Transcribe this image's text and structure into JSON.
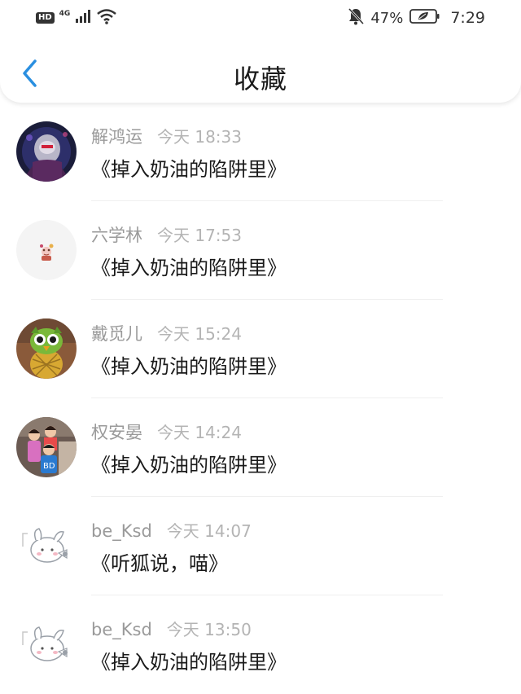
{
  "status_bar": {
    "hd": "HD",
    "network": "4G",
    "battery_percent": "47%",
    "time": "7:29"
  },
  "header": {
    "title": "收藏",
    "back_icon": "chevron-left-icon",
    "accent_color": "#2a8fe0"
  },
  "favorites": [
    {
      "user": "解鸿运",
      "time": "今天 18:33",
      "book": "《掉入奶油的陷阱里》",
      "avatar": "avatar-robot"
    },
    {
      "user": "六学林",
      "time": "今天 17:53",
      "book": "《掉入奶油的陷阱里》",
      "avatar": "avatar-sticker"
    },
    {
      "user": "戴觅儿",
      "time": "今天 15:24",
      "book": "《掉入奶油的陷阱里》",
      "avatar": "avatar-pineapple-owl"
    },
    {
      "user": "权安晏",
      "time": "今天 14:24",
      "book": "《掉入奶油的陷阱里》",
      "avatar": "avatar-kids-photo"
    },
    {
      "user": "be_Ksd",
      "time": "今天 14:07",
      "book": "《听狐说，喵》",
      "avatar": "avatar-bunny-sketch"
    },
    {
      "user": "be_Ksd",
      "time": "今天 13:50",
      "book": "《掉入奶油的陷阱里》",
      "avatar": "avatar-bunny-sketch"
    }
  ]
}
